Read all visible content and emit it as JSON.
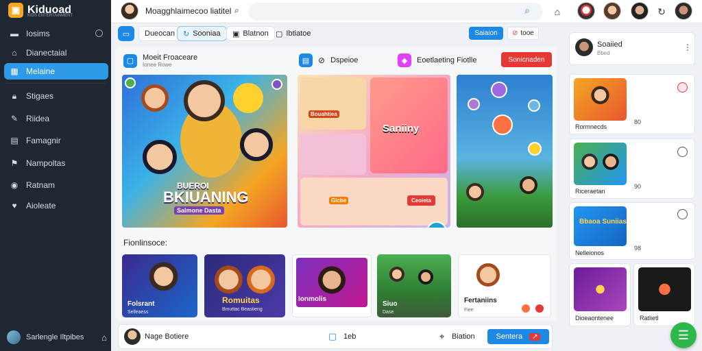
{
  "app": {
    "name": "Kiduoad",
    "tagline": "KIDS ENTERTAINMENT"
  },
  "sidebar": {
    "items": [
      {
        "label": "Iosims",
        "icon": "menu-icon"
      },
      {
        "label": "Dianectaial",
        "icon": "home-icon"
      },
      {
        "label": "Melaine",
        "icon": "grid-icon"
      },
      {
        "label": "Stigaes",
        "icon": "lock-icon"
      },
      {
        "label": "Riidea",
        "icon": "pencil-icon"
      },
      {
        "label": "Famagnir",
        "icon": "document-icon"
      },
      {
        "label": "Nampoltas",
        "icon": "flag-icon"
      },
      {
        "label": "Ratnam",
        "icon": "globe-icon"
      },
      {
        "label": "Aioleate",
        "icon": "heart-icon"
      }
    ],
    "user": {
      "name": "Sarlengle Iltpibes"
    }
  },
  "topbar": {
    "search_label": "Moagghlaimecoo liatitel",
    "search_placeholder": ""
  },
  "filters": {
    "chips": [
      "Dueocan",
      "Sooniaa",
      "Blatnon",
      "Ibtiatoe"
    ],
    "primary_action": "Saiaion",
    "secondary_action": "tooe"
  },
  "main": {
    "section1": {
      "title": "Moeit Froaceare",
      "subtitle": "Ionee Rowe"
    },
    "section2": {
      "label": "Dspeioe"
    },
    "section3": {
      "label": "Eoetlaeting Fiotlle"
    },
    "action_button": "Sonicnaden",
    "hero": {
      "title": "BKIUANING",
      "top_line": "BUEROI",
      "tagline": "Salmone Dasta"
    },
    "card2": {
      "sign": "Bouahtiea",
      "center": "Saniiny",
      "tag": "Ceoieta",
      "bottom": "Glcbe"
    },
    "recommend_label": "Fionlinsoce:",
    "recommendations": [
      {
        "title": "Folsrant",
        "subtitle": "Selleaess"
      },
      {
        "title": "Romuitas",
        "subtitle": "Bmuttac Beastieng"
      },
      {
        "title": "Ionmolis",
        "subtitle": ""
      },
      {
        "title": "Siuo",
        "subtitle": "Dase"
      },
      {
        "title": "Fertaniins",
        "subtitle": "Fiee"
      }
    ]
  },
  "bottom_bar": {
    "name": "Nage Botiere",
    "count": "1eb",
    "status": "Biation",
    "save_label": "Sentera"
  },
  "right_panel": {
    "profile": {
      "name": "Soaiied",
      "sub": "Bbed"
    },
    "items": [
      {
        "title": "Rormnecds",
        "meta": "80"
      },
      {
        "title": "Riceraetan",
        "meta": "90"
      },
      {
        "title": "Nelleionos",
        "meta": "98"
      },
      {
        "title": "Dioeaontenee",
        "meta": ""
      },
      {
        "title": "Ratlietl",
        "meta": ""
      }
    ],
    "card3_label": "Bbaoa Suniias"
  },
  "colors": {
    "sidebar_bg": "#1f2733",
    "accent_blue": "#1e88e5",
    "accent_red": "#e53935",
    "accent_green": "#2eb84b",
    "active_item": "#2f9be8"
  }
}
